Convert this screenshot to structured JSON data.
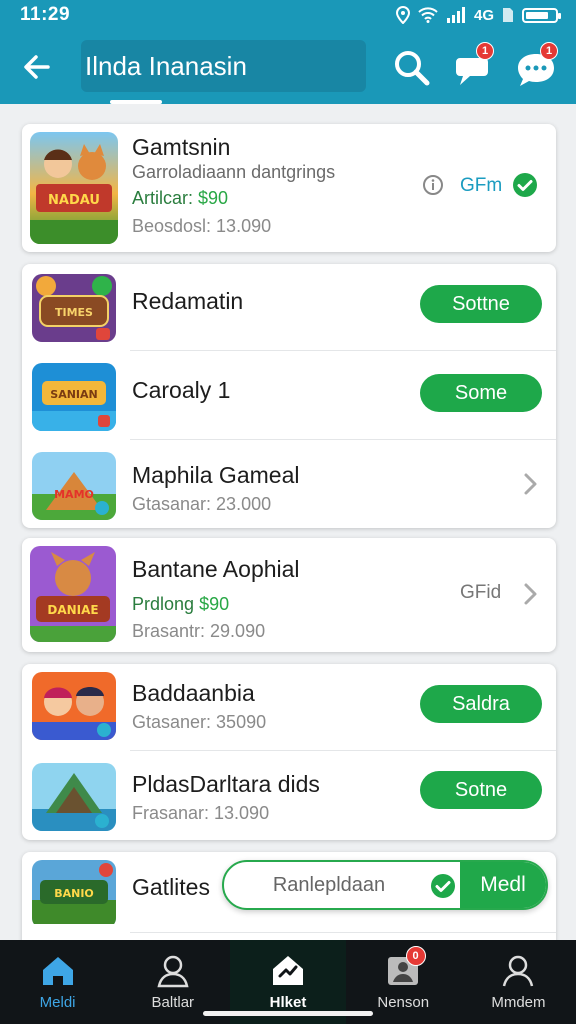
{
  "status_bar": {
    "time": "11:29",
    "network": "4G"
  },
  "app_bar": {
    "search_value": "Ilnda Inanasin",
    "chat_badge": "1",
    "message_badge": "1"
  },
  "featured": {
    "title": "Gamtsnin",
    "subtitle": "Garroladiaann dantgrings",
    "price_label": "Artilcar:",
    "price_value": "$90",
    "meta": "Beosdosl: 13.090",
    "status_label": "GFm",
    "thumb_text": "NADAU"
  },
  "list_group_1": [
    {
      "title": "Redamatin",
      "thumb_text": "TIMES",
      "action": "Sottne"
    },
    {
      "title": "Caroaly 1",
      "thumb_text": "SANIAN",
      "action": "Some"
    },
    {
      "title": "Maphila Gameal",
      "meta": "Gtasanar: 23.000",
      "thumb_text": "MAMO"
    },
    {
      "title": "Bantane Aophial",
      "price_label": "Prdlong",
      "price_value": "$90",
      "meta": "Brasantr: 29.090",
      "side_label": "GFid",
      "thumb_text": "DANIAE"
    }
  ],
  "list_group_2": [
    {
      "title": "Baddaanbia",
      "meta": "Gtasaner: 35090",
      "action": "Saldra",
      "thumb_text": ""
    },
    {
      "title": "PldasDarltara dids",
      "meta": "Frasanar: 13.090",
      "action": "Sotne",
      "thumb_text": ""
    }
  ],
  "list_group_3": [
    {
      "title": "Gatlites",
      "thumb_text": "BANIO"
    }
  ],
  "floating_pill": {
    "left_label": "Ranlepldaan",
    "right_label": "Medl"
  },
  "bottom_nav": [
    {
      "label": "Meldi",
      "icon": "home-icon"
    },
    {
      "label": "Baltlar",
      "icon": "person-outline-icon"
    },
    {
      "label": "Hlket",
      "icon": "game-house-icon"
    },
    {
      "label": "Nenson",
      "icon": "account-box-icon",
      "badge": "0"
    },
    {
      "label": "Mmdem",
      "icon": "profile-icon"
    }
  ],
  "colors": {
    "header": "#1a98b8",
    "accent_green": "#1ea84a",
    "nav_active": "#3ea6e6",
    "badge": "#e53935"
  }
}
